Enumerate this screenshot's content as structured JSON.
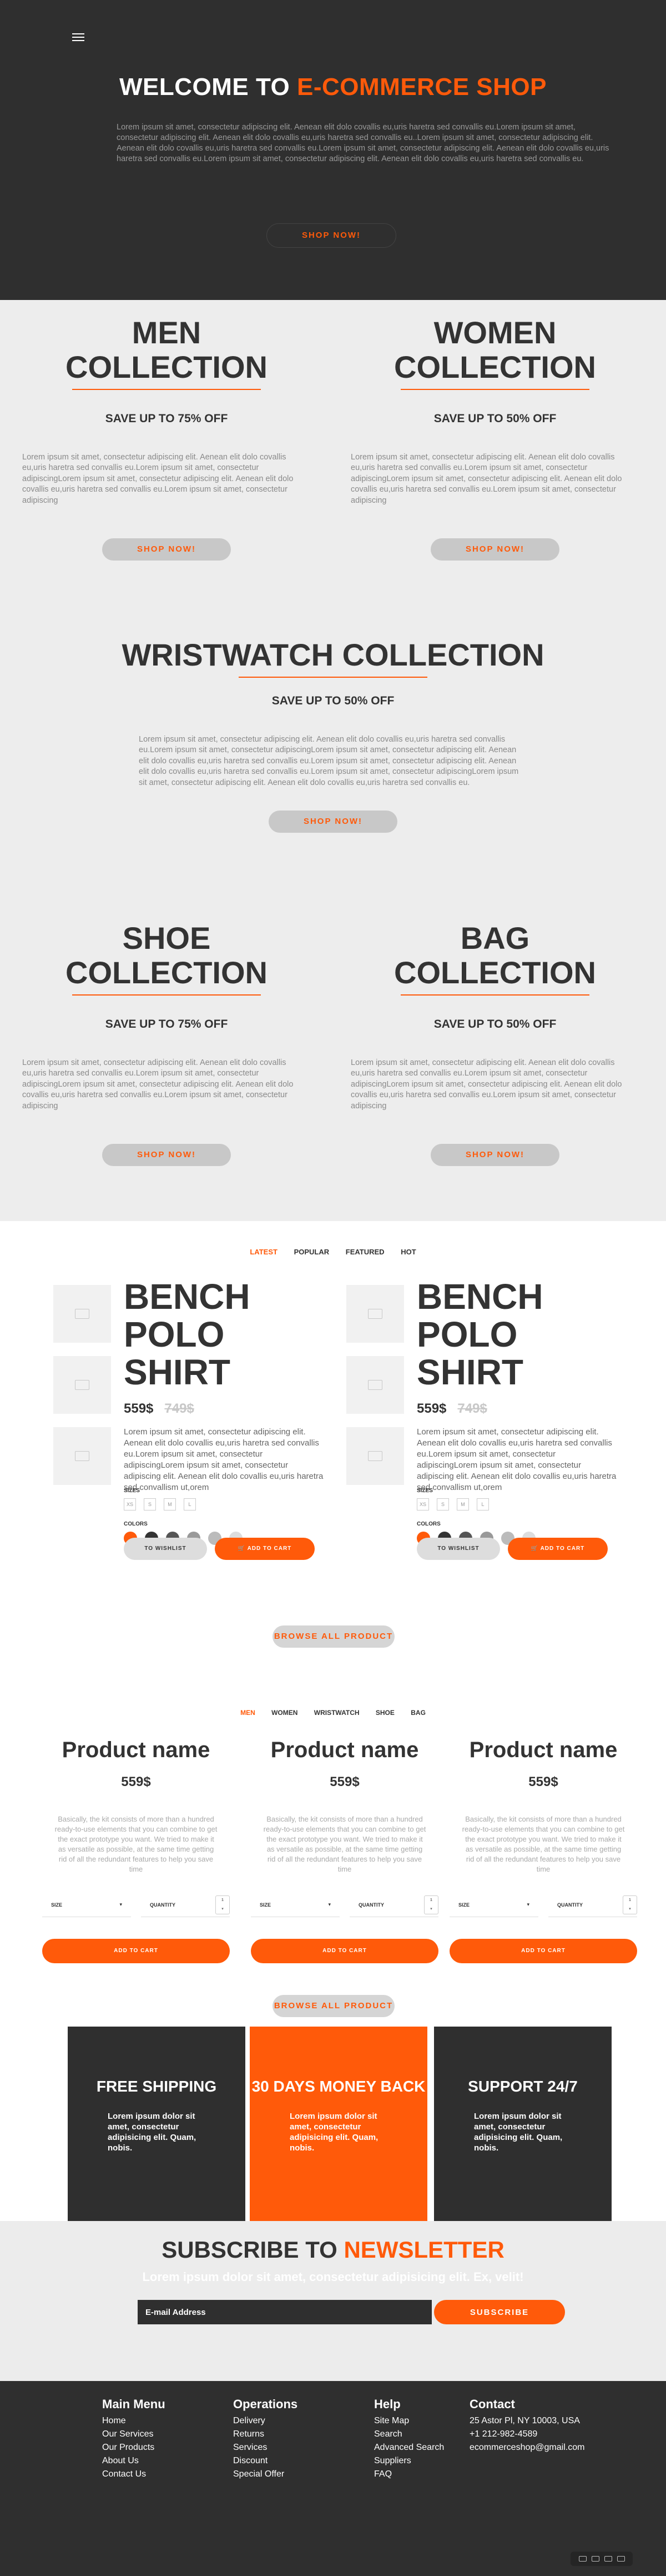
{
  "hero": {
    "title_prefix": "WELCOME TO ",
    "title_highlight": "E-COMMERCE SHOP",
    "body": "Lorem ipsum sit amet, consectetur adipiscing elit. Aenean elit dolo covallis eu,uris haretra sed convallis eu.Lorem ipsum sit amet, consectetur adipiscing elit. Aenean elit dolo covallis eu,uris haretra sed convallis eu..Lorem ipsum sit amet, consectetur adipiscing elit. Aenean elit dolo covallis eu,uris haretra sed convallis eu.Lorem ipsum sit amet, consectetur adipiscing elit. Aenean elit dolo covallis eu,uris haretra sed convallis eu.Lorem ipsum sit amet, consectetur adipiscing elit. Aenean elit dolo covallis eu,uris haretra sed convallis eu.",
    "cta": "SHOP NOW!"
  },
  "collections": {
    "lorem": "Lorem ipsum sit amet, consectetur adipiscing elit. Aenean elit dolo covallis eu,uris haretra sed convallis eu.Lorem ipsum sit amet, consectetur adipiscingLorem ipsum sit amet, consectetur adipiscing elit. Aenean elit dolo covallis eu,uris haretra sed convallis eu.Lorem ipsum sit amet, consectetur adipiscing",
    "wrist_lorem": "Lorem ipsum sit amet, consectetur adipiscing elit. Aenean elit dolo covallis eu,uris haretra sed convallis eu.Lorem ipsum sit amet, consectetur adipiscingLorem ipsum sit amet, consectetur adipiscing elit. Aenean elit dolo covallis eu,uris haretra sed convallis eu.Lorem ipsum sit amet, consectetur adipiscing elit. Aenean elit dolo covallis eu,uris haretra sed convallis eu.Lorem ipsum sit amet, consectetur adipiscingLorem ipsum sit amet, consectetur adipiscing elit. Aenean elit dolo covallis eu,uris haretra sed convallis eu.",
    "cta": "SHOP NOW!",
    "men": {
      "title1": "MEN",
      "title2": "COLLECTION",
      "offer": "SAVE UP TO 75% OFF"
    },
    "women": {
      "title1": "WOMEN",
      "title2": "COLLECTION",
      "offer": "SAVE UP TO 50% OFF"
    },
    "wrist": {
      "title": "WRISTWATCH COLLECTION",
      "offer": "SAVE UP TO 50% OFF"
    },
    "shoe": {
      "title1": "SHOE",
      "title2": "COLLECTION",
      "offer": "SAVE UP TO 75% OFF"
    },
    "bag": {
      "title1": "BAG",
      "title2": "COLLECTION",
      "offer": "SAVE UP TO 50% OFF"
    }
  },
  "product_tabs": [
    "LATEST",
    "POPULAR",
    "FEATURED",
    "HOT"
  ],
  "featured": {
    "name1": "BENCH",
    "name2": "POLO SHIRT",
    "price": "559$",
    "old_price": "749$",
    "desc": "Lorem ipsum sit amet, consectetur adipiscing elit. Aenean elit dolo covallis eu,uris haretra sed convallis eu.Lorem ipsum sit amet, consectetur adipiscingLorem ipsum sit amet, consectetur adipiscing elit. Aenean elit dolo covallis eu,uris haretra sed convallism ut,orem",
    "sizes_label": "SIZES",
    "sizes": [
      "XS",
      "S",
      "M",
      "L"
    ],
    "colors_label": "COLORS",
    "swatches": [
      "#ff5a0a",
      "#333333",
      "#555555",
      "#999999",
      "#bbbbbb",
      "#dddddd"
    ],
    "wishlist": "TO WISHLIST",
    "add": "ADD TO CART"
  },
  "browse": "BROWSE ALL PRODUCT",
  "category_tabs": [
    "MEN",
    "WOMEN",
    "WRISTWATCH",
    "SHOE",
    "BAG"
  ],
  "grid": {
    "name": "Product name",
    "price": "559$",
    "desc": "Basically, the kit consists of more than a hundred ready-to-use elements that you can combine to get the exact prototype you want. We tried to make it as versatile as possible, at the same time getting rid of all the redundant features to help you save time",
    "size_label": "SIZE",
    "qty_label": "QUANTITY",
    "qty_value": "1",
    "add": "ADD TO CART"
  },
  "features": [
    {
      "title": "FREE SHIPPING",
      "text": "Lorem ipsum dolor sit amet, consectetur adipisicing elit. Quam, nobis."
    },
    {
      "title": "30 DAYS MONEY BACK",
      "text": "Lorem ipsum dolor sit amet, consectetur adipisicing elit. Quam, nobis."
    },
    {
      "title": "SUPPORT 24/7",
      "text": "Lorem ipsum dolor sit amet, consectetur adipisicing elit. Quam, nobis."
    }
  ],
  "newsletter": {
    "title_prefix": "SUBSCRIBE TO ",
    "title_highlight": "NEWSLETTER",
    "subtitle": "Lorem ipsum dolor sit amet, consectetur adipisicing elit. Ex, velit!",
    "placeholder": "E-mail Address",
    "button": "SUBSCRIBE"
  },
  "footer": {
    "main_menu": {
      "title": "Main Menu",
      "links": [
        "Home",
        "Our Services",
        "Our Products",
        "About Us",
        "Contact Us"
      ]
    },
    "operations": {
      "title": "Operations",
      "links": [
        "Delivery",
        "Returns",
        "Services",
        "Discount",
        "Special Offer"
      ]
    },
    "help": {
      "title": "Help",
      "links": [
        "Site Map",
        "Search",
        "Advanced Search",
        "Suppliers",
        "FAQ"
      ]
    },
    "contact": {
      "title": "Contact",
      "lines": [
        "25 Astor Pl, NY 10003, USA",
        "+1 212-982-4589",
        "ecommerceshop@gmail.com"
      ]
    }
  },
  "colors": {
    "accent": "#ff5a0a",
    "dark": "#2f2f2f",
    "light": "#ededed"
  }
}
